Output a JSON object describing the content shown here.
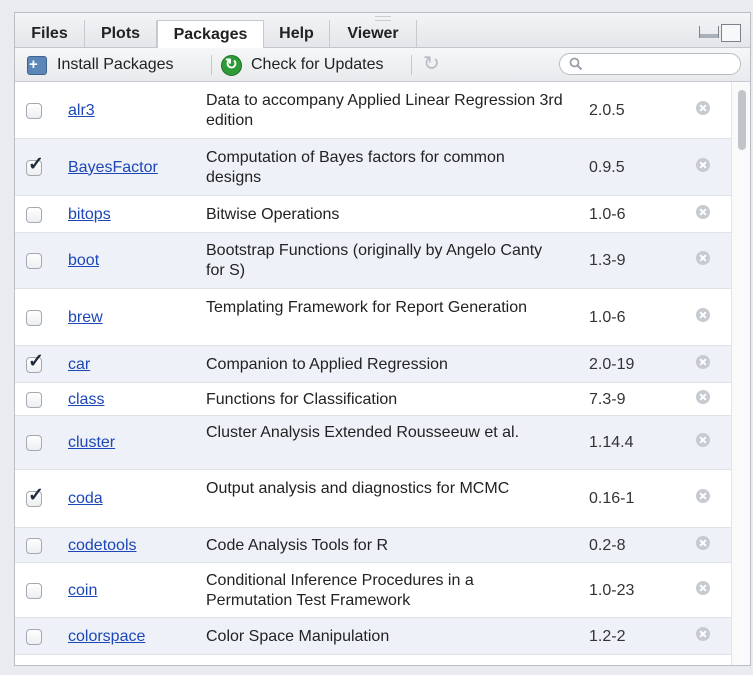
{
  "tabs": [
    {
      "label": "Files"
    },
    {
      "label": "Plots"
    },
    {
      "label": "Packages"
    },
    {
      "label": "Help"
    },
    {
      "label": "Viewer"
    }
  ],
  "active_tab": "Packages",
  "toolbar": {
    "install_label": "Install Packages",
    "update_label": "Check for Updates",
    "search_placeholder": "",
    "search_value": ""
  },
  "packages": [
    {
      "name": "alr3",
      "desc": "Data to accompany Applied Linear Regression 3rd edition",
      "version": "2.0.5",
      "checked": false
    },
    {
      "name": "BayesFactor",
      "desc": "Computation of Bayes factors for common designs",
      "version": "0.9.5",
      "checked": true
    },
    {
      "name": "bitops",
      "desc": "Bitwise Operations",
      "version": "1.0-6",
      "checked": false
    },
    {
      "name": "boot",
      "desc": "Bootstrap Functions (originally by Angelo Canty for S)",
      "version": "1.3-9",
      "checked": false
    },
    {
      "name": "brew",
      "desc": "Templating Framework for Report Generation",
      "version": "1.0-6",
      "checked": false
    },
    {
      "name": "car",
      "desc": "Companion to Applied Regression",
      "version": "2.0-19",
      "checked": true
    },
    {
      "name": "class",
      "desc": "Functions for Classification",
      "version": "7.3-9",
      "checked": false
    },
    {
      "name": "cluster",
      "desc": "Cluster Analysis Extended Rousseeuw et al.",
      "version": "1.14.4",
      "checked": false
    },
    {
      "name": "coda",
      "desc": "Output analysis and diagnostics for MCMC",
      "version": "0.16-1",
      "checked": true
    },
    {
      "name": "codetools",
      "desc": "Code Analysis Tools for R",
      "version": "0.2-8",
      "checked": false
    },
    {
      "name": "coin",
      "desc": "Conditional Inference Procedures in a Permutation Test Framework",
      "version": "1.0-23",
      "checked": false
    },
    {
      "name": "colorspace",
      "desc": "Color Space Manipulation",
      "version": "1.2-2",
      "checked": false
    }
  ]
}
